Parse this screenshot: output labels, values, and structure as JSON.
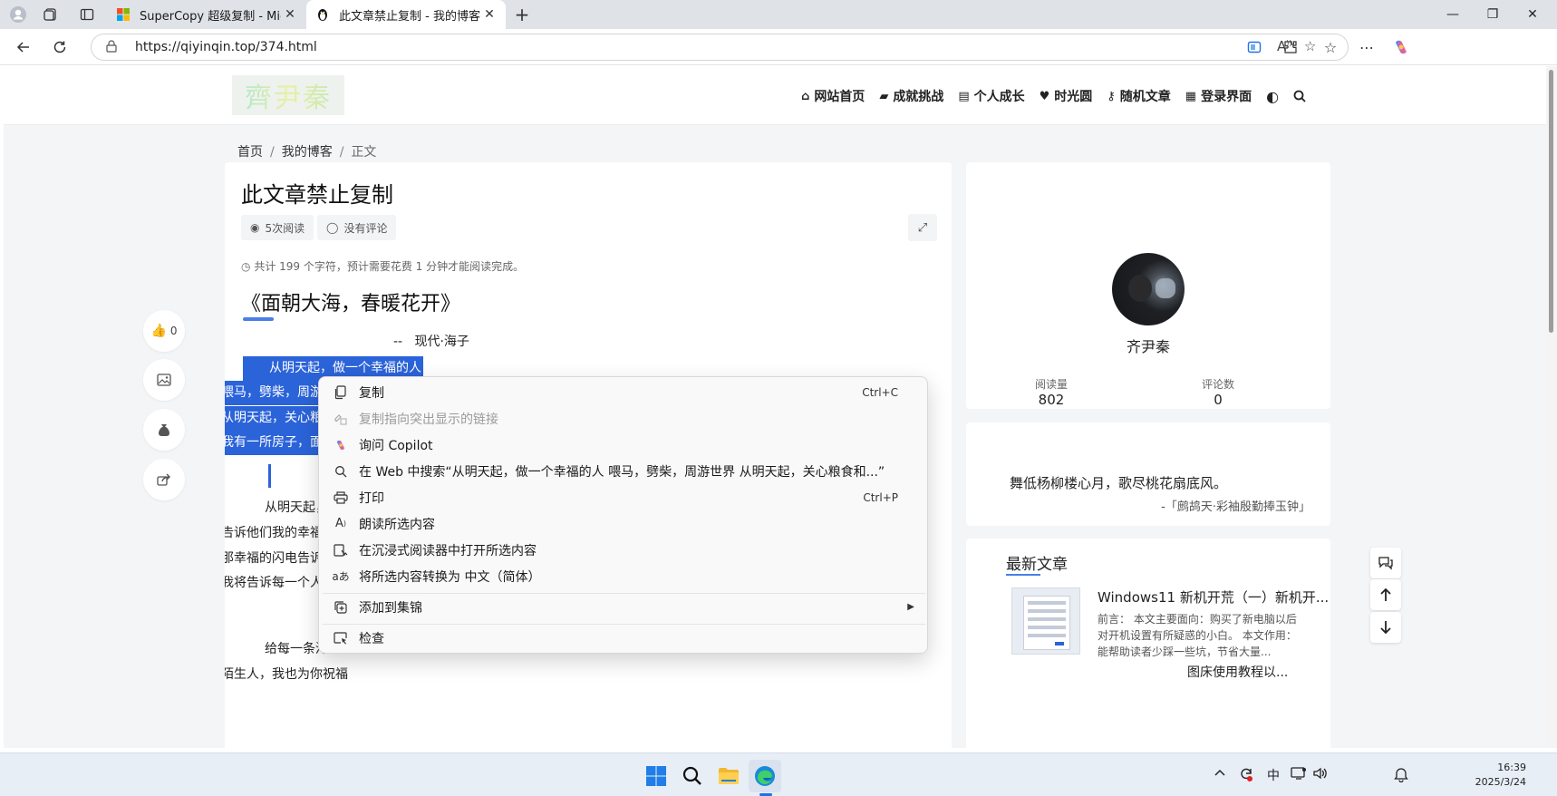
{
  "browser": {
    "tabs": [
      {
        "title": "SuperCopy 超级复制 - Microsoft E",
        "active": false,
        "close": "✕"
      },
      {
        "title": "此文章禁止复制 - 我的博客",
        "active": true,
        "close": "✕"
      }
    ],
    "new_tab": "+",
    "url": "https://qiyinqin.top/374.html",
    "window_controls": [
      "—",
      "❐",
      "✕"
    ]
  },
  "site": {
    "logo_text": "齊尹秦",
    "nav": [
      {
        "icon": "home-icon",
        "glyph": "⌂",
        "label": "网站首页"
      },
      {
        "icon": "folder-icon",
        "glyph": "▰",
        "label": "成就挑战"
      },
      {
        "icon": "book-icon",
        "glyph": "▤",
        "label": "个人成长"
      },
      {
        "icon": "heart-icon",
        "glyph": "♥",
        "label": "时光圆"
      },
      {
        "icon": "key-icon",
        "glyph": "⚷",
        "label": "随机文章"
      },
      {
        "icon": "grid-icon",
        "glyph": "▦",
        "label": "登录界面"
      }
    ],
    "theme_toggle_glyph": "◐",
    "search_glyph": "⌕"
  },
  "breadcrumb": {
    "home": "首页",
    "sep": "/",
    "category": "我的博客",
    "current": "正文"
  },
  "article": {
    "title": "此文章禁止复制",
    "views": "5次阅读",
    "comments": "没有评论",
    "word_count": "共计 199 个字符，预计需要花费 1 分钟才能阅读完成。",
    "poem_title": "《面朝大海，春暖花开》",
    "poem_author": "--   现代·海子",
    "selected_lines": [
      "从明天起，做一个幸福的人",
      "喂马，劈柴，周游",
      "从明天起，关心粮",
      "我有一所房子，面"
    ],
    "lines": [
      "从明天起，和",
      "告诉他们我的幸福",
      "那幸福的闪电告诉",
      "我将告诉每一个人",
      "给每一条河每",
      "陌生人，我也为你祝福"
    ]
  },
  "left_actions": {
    "like_count": "0"
  },
  "profile": {
    "name": "齐尹秦",
    "reads_label": "阅读量",
    "reads_value": "802",
    "comments_label": "评论数",
    "comments_value": "0"
  },
  "quote": {
    "text": "舞低杨柳楼心月，歌尽桃花扇底风。",
    "source": "-「鹧鸪天·彩袖殷勤捧玉钟」"
  },
  "recent": {
    "heading": "最新文章",
    "title": "Windows11 新机开荒（一）新机开...",
    "desc": "前言： 本文主要面向：购买了新电脑以后对开机设置有所疑惑的小白。 本文作用：能帮助读者少踩一些坑，节省大量...",
    "next_title": "图床使用教程以..."
  },
  "context_menu": {
    "items": [
      {
        "icon": "copy-icon",
        "label": "复制",
        "shortcut": "Ctrl+C",
        "disabled": false
      },
      {
        "icon": "link-copy-icon",
        "label": "复制指向突出显示的链接",
        "shortcut": "",
        "disabled": true
      },
      {
        "icon": "copilot-icon",
        "label": "询问 Copilot",
        "shortcut": "",
        "disabled": false
      },
      {
        "icon": "search-icon",
        "label": "在 Web 中搜索“从明天起，做一个幸福的人 喂马，劈柴，周游世界 从明天起，关心粮食和...”",
        "shortcut": "",
        "disabled": false
      },
      {
        "icon": "print-icon",
        "label": "打印",
        "shortcut": "Ctrl+P",
        "disabled": false
      },
      {
        "icon": "read-aloud-icon",
        "label": "朗读所选内容",
        "shortcut": "",
        "disabled": false
      },
      {
        "icon": "immersive-reader-icon",
        "label": "在沉浸式阅读器中打开所选内容",
        "shortcut": "",
        "disabled": false
      },
      {
        "icon": "translate-icon",
        "label": "将所选内容转换为 中文（简体）",
        "shortcut": "",
        "disabled": false
      }
    ],
    "collections": {
      "icon": "collections-icon",
      "label": "添加到集锦"
    },
    "inspect": {
      "icon": "inspect-icon",
      "label": "检查"
    }
  },
  "taskbar": {
    "ime": "中",
    "time": "16:39",
    "date": "2025/3/24"
  },
  "colors": {
    "selection": "#2b63d9",
    "accent": "#4a7fe8"
  }
}
